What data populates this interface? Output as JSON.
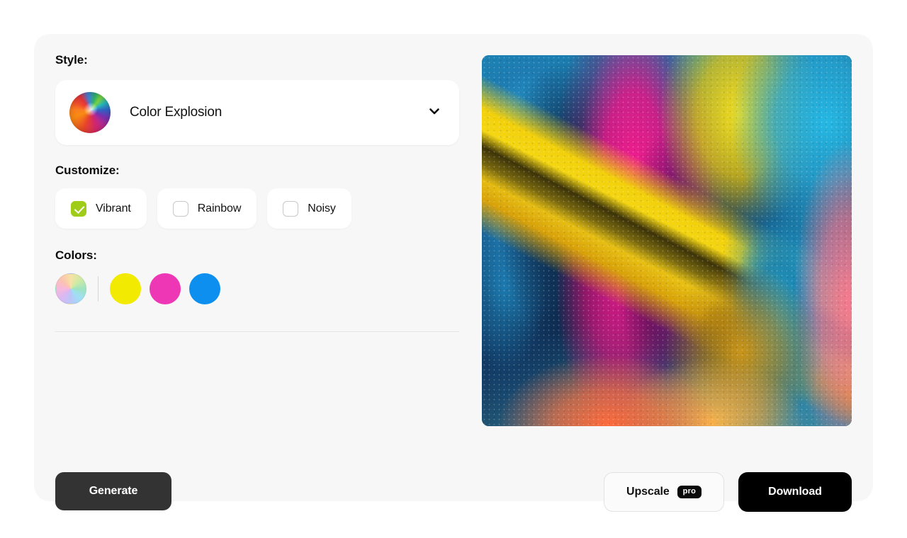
{
  "card": {
    "background_color": "#f7f7f7"
  },
  "style_section": {
    "label": "Style:",
    "selected": "Color Explosion",
    "thumbnail_icon": "color-burst-thumbnail",
    "chevron_icon": "chevron-down-icon"
  },
  "customize_section": {
    "label": "Customize:",
    "options": [
      {
        "label": "Vibrant",
        "checked": true
      },
      {
        "label": "Rainbow",
        "checked": false
      },
      {
        "label": "Noisy",
        "checked": false
      }
    ],
    "checked_color": "#9fcc16"
  },
  "colors_section": {
    "label": "Colors:",
    "swatches": [
      {
        "name": "color-wheel-picker",
        "color": "rainbow"
      },
      {
        "name": "swatch-yellow",
        "color": "#f2ea00"
      },
      {
        "name": "swatch-magenta",
        "color": "#ee37b4"
      },
      {
        "name": "swatch-blue",
        "color": "#0d8ff0"
      }
    ]
  },
  "actions": {
    "generate_label": "Generate",
    "generate_color": "#333333",
    "upscale_label": "Upscale",
    "upscale_badge": "pro",
    "download_label": "Download",
    "download_color": "#000000"
  },
  "preview": {
    "alt": "colorful powder explosion preview image"
  }
}
